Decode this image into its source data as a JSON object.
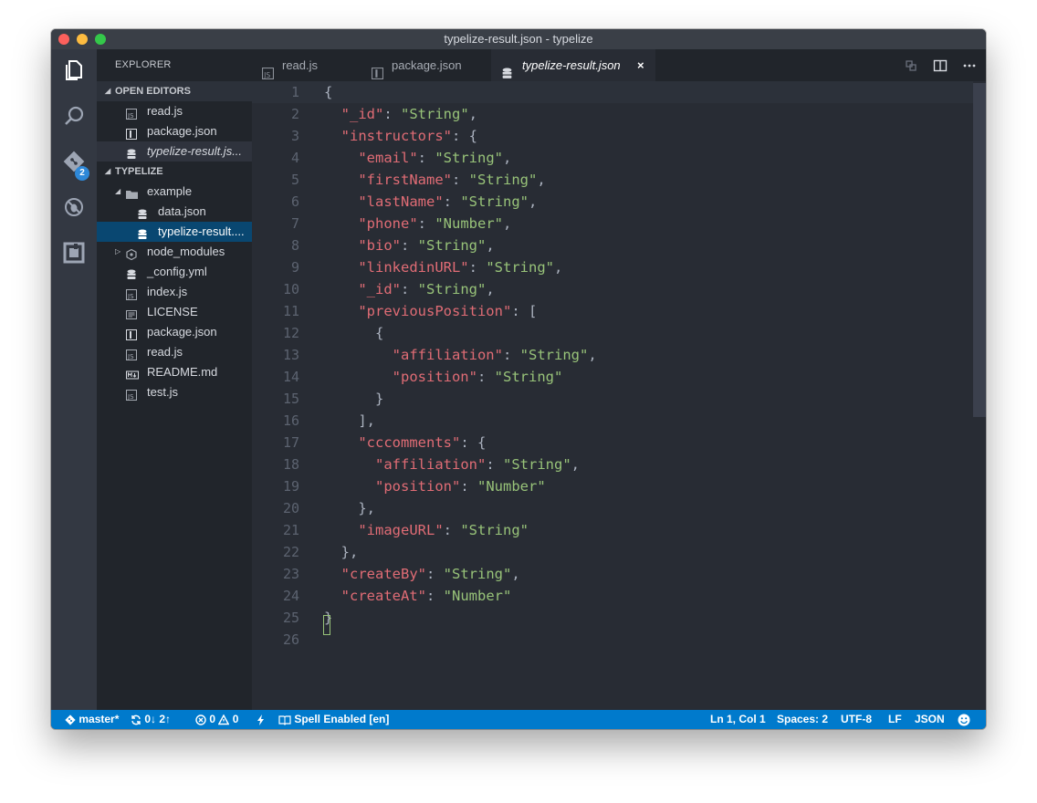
{
  "window": {
    "title": "typelize-result.json - typelize"
  },
  "activity_bar": {
    "items": [
      {
        "icon": "files-icon"
      },
      {
        "icon": "search-icon"
      },
      {
        "icon": "git-icon",
        "badge": "2"
      },
      {
        "icon": "debug-icon"
      },
      {
        "icon": "extensions-icon"
      }
    ]
  },
  "sidebar": {
    "title": "EXPLORER",
    "open_editors": {
      "header": "OPEN EDITORS",
      "items": [
        {
          "name": "read.js",
          "icon": "js-file-icon"
        },
        {
          "name": "package.json",
          "icon": "package-file-icon"
        },
        {
          "name": "typelize-result.js...",
          "icon": "database-file-icon"
        }
      ]
    },
    "project": {
      "header": "TYPELIZE",
      "items": [
        {
          "name": "example",
          "icon": "folder-icon"
        },
        {
          "name": "data.json",
          "icon": "database-file-icon"
        },
        {
          "name": "typelize-result....",
          "icon": "database-file-icon"
        },
        {
          "name": "node_modules",
          "icon": "node-icon"
        },
        {
          "name": "_config.yml",
          "icon": "database-file-icon"
        },
        {
          "name": "index.js",
          "icon": "js-file-icon"
        },
        {
          "name": "LICENSE",
          "icon": "license-file-icon"
        },
        {
          "name": "package.json",
          "icon": "package-file-icon"
        },
        {
          "name": "read.js",
          "icon": "js-file-icon"
        },
        {
          "name": "README.md",
          "icon": "markdown-file-icon"
        },
        {
          "name": "test.js",
          "icon": "js-file-icon"
        }
      ]
    }
  },
  "tabs": [
    {
      "label": "read.js",
      "icon": "js-file-icon"
    },
    {
      "label": "package.json",
      "icon": "package-file-icon"
    },
    {
      "label": "typelize-result.json",
      "icon": "database-file-icon",
      "close": "×"
    }
  ],
  "editor": {
    "line_numbers": [
      "1",
      "2",
      "3",
      "4",
      "5",
      "6",
      "7",
      "8",
      "9",
      "10",
      "11",
      "12",
      "13",
      "14",
      "15",
      "16",
      "17",
      "18",
      "19",
      "20",
      "21",
      "22",
      "23",
      "24",
      "25",
      "26"
    ],
    "lines": [
      [
        {
          "t": "p",
          "v": "{"
        }
      ],
      [
        {
          "t": "p",
          "v": "  "
        },
        {
          "t": "k",
          "v": "\"_id\""
        },
        {
          "t": "p",
          "v": ": "
        },
        {
          "t": "s",
          "v": "\"String\""
        },
        {
          "t": "p",
          "v": ","
        }
      ],
      [
        {
          "t": "p",
          "v": "  "
        },
        {
          "t": "k",
          "v": "\"instructors\""
        },
        {
          "t": "p",
          "v": ": {"
        }
      ],
      [
        {
          "t": "p",
          "v": "    "
        },
        {
          "t": "k",
          "v": "\"email\""
        },
        {
          "t": "p",
          "v": ": "
        },
        {
          "t": "s",
          "v": "\"String\""
        },
        {
          "t": "p",
          "v": ","
        }
      ],
      [
        {
          "t": "p",
          "v": "    "
        },
        {
          "t": "k",
          "v": "\"firstName\""
        },
        {
          "t": "p",
          "v": ": "
        },
        {
          "t": "s",
          "v": "\"String\""
        },
        {
          "t": "p",
          "v": ","
        }
      ],
      [
        {
          "t": "p",
          "v": "    "
        },
        {
          "t": "k",
          "v": "\"lastName\""
        },
        {
          "t": "p",
          "v": ": "
        },
        {
          "t": "s",
          "v": "\"String\""
        },
        {
          "t": "p",
          "v": ","
        }
      ],
      [
        {
          "t": "p",
          "v": "    "
        },
        {
          "t": "k",
          "v": "\"phone\""
        },
        {
          "t": "p",
          "v": ": "
        },
        {
          "t": "s",
          "v": "\"Number\""
        },
        {
          "t": "p",
          "v": ","
        }
      ],
      [
        {
          "t": "p",
          "v": "    "
        },
        {
          "t": "k",
          "v": "\"bio\""
        },
        {
          "t": "p",
          "v": ": "
        },
        {
          "t": "s",
          "v": "\"String\""
        },
        {
          "t": "p",
          "v": ","
        }
      ],
      [
        {
          "t": "p",
          "v": "    "
        },
        {
          "t": "k",
          "v": "\"linkedinURL\""
        },
        {
          "t": "p",
          "v": ": "
        },
        {
          "t": "s",
          "v": "\"String\""
        },
        {
          "t": "p",
          "v": ","
        }
      ],
      [
        {
          "t": "p",
          "v": "    "
        },
        {
          "t": "k",
          "v": "\"_id\""
        },
        {
          "t": "p",
          "v": ": "
        },
        {
          "t": "s",
          "v": "\"String\""
        },
        {
          "t": "p",
          "v": ","
        }
      ],
      [
        {
          "t": "p",
          "v": "    "
        },
        {
          "t": "k",
          "v": "\"previousPosition\""
        },
        {
          "t": "p",
          "v": ": ["
        }
      ],
      [
        {
          "t": "p",
          "v": "      {"
        }
      ],
      [
        {
          "t": "p",
          "v": "        "
        },
        {
          "t": "k",
          "v": "\"affiliation\""
        },
        {
          "t": "p",
          "v": ": "
        },
        {
          "t": "s",
          "v": "\"String\""
        },
        {
          "t": "p",
          "v": ","
        }
      ],
      [
        {
          "t": "p",
          "v": "        "
        },
        {
          "t": "k",
          "v": "\"position\""
        },
        {
          "t": "p",
          "v": ": "
        },
        {
          "t": "s",
          "v": "\"String\""
        }
      ],
      [
        {
          "t": "p",
          "v": "      }"
        }
      ],
      [
        {
          "t": "p",
          "v": "    ],"
        }
      ],
      [
        {
          "t": "p",
          "v": "    "
        },
        {
          "t": "k",
          "v": "\"cccomments\""
        },
        {
          "t": "p",
          "v": ": {"
        }
      ],
      [
        {
          "t": "p",
          "v": "      "
        },
        {
          "t": "k",
          "v": "\"affiliation\""
        },
        {
          "t": "p",
          "v": ": "
        },
        {
          "t": "s",
          "v": "\"String\""
        },
        {
          "t": "p",
          "v": ","
        }
      ],
      [
        {
          "t": "p",
          "v": "      "
        },
        {
          "t": "k",
          "v": "\"position\""
        },
        {
          "t": "p",
          "v": ": "
        },
        {
          "t": "s",
          "v": "\"Number\""
        }
      ],
      [
        {
          "t": "p",
          "v": "    },"
        }
      ],
      [
        {
          "t": "p",
          "v": "    "
        },
        {
          "t": "k",
          "v": "\"imageURL\""
        },
        {
          "t": "p",
          "v": ": "
        },
        {
          "t": "s",
          "v": "\"String\""
        }
      ],
      [
        {
          "t": "p",
          "v": "  },"
        }
      ],
      [
        {
          "t": "p",
          "v": "  "
        },
        {
          "t": "k",
          "v": "\"createBy\""
        },
        {
          "t": "p",
          "v": ": "
        },
        {
          "t": "s",
          "v": "\"String\""
        },
        {
          "t": "p",
          "v": ","
        }
      ],
      [
        {
          "t": "p",
          "v": "  "
        },
        {
          "t": "k",
          "v": "\"createAt\""
        },
        {
          "t": "p",
          "v": ": "
        },
        {
          "t": "s",
          "v": "\"Number\""
        }
      ],
      [
        {
          "t": "p",
          "v": "}"
        }
      ],
      []
    ]
  },
  "status_bar": {
    "branch": "master*",
    "sync": "0↓ 2↑",
    "errors": "0",
    "warnings": "0",
    "spell": "Spell Enabled [en]",
    "position": "Ln 1, Col 1",
    "spaces": "Spaces: 2",
    "encoding": "UTF-8",
    "eol": "LF",
    "language": "JSON"
  },
  "colors": {
    "key": "#e06c75",
    "string": "#98c379",
    "status_bar": "#007acc",
    "selection": "#094771"
  }
}
